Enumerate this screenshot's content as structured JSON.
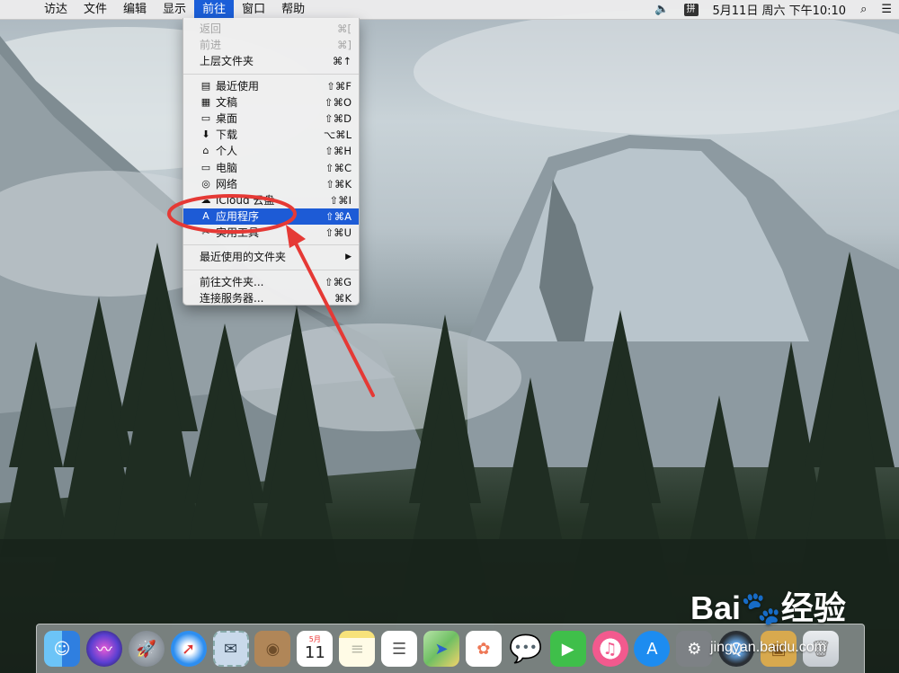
{
  "menubar": {
    "apple_icon": "apple-icon",
    "items": [
      {
        "label": "访达",
        "active": false
      },
      {
        "label": "文件",
        "active": false
      },
      {
        "label": "编辑",
        "active": false
      },
      {
        "label": "显示",
        "active": false
      },
      {
        "label": "前往",
        "active": true
      },
      {
        "label": "窗口",
        "active": false
      },
      {
        "label": "帮助",
        "active": false
      }
    ],
    "input_badge": "拼",
    "clock": "5月11日 周六 下午10:10"
  },
  "go_menu": {
    "items": [
      {
        "label": "返回",
        "shortcut": "⌘[",
        "disabled": true
      },
      {
        "label": "前进",
        "shortcut": "⌘]",
        "disabled": true
      },
      {
        "label": "上层文件夹",
        "shortcut": "⌘↑"
      },
      {
        "label": "最近使用",
        "shortcut": "⇧⌘F",
        "icon": "recents-icon"
      },
      {
        "label": "文稿",
        "shortcut": "⇧⌘O",
        "icon": "documents-icon"
      },
      {
        "label": "桌面",
        "shortcut": "⇧⌘D",
        "icon": "desktop-icon"
      },
      {
        "label": "下载",
        "shortcut": "⌥⌘L",
        "icon": "download-icon"
      },
      {
        "label": "个人",
        "shortcut": "⇧⌘H",
        "icon": "home-icon"
      },
      {
        "label": "电脑",
        "shortcut": "⇧⌘C",
        "icon": "computer-icon"
      },
      {
        "label": "网络",
        "shortcut": "⇧⌘K",
        "icon": "network-icon"
      },
      {
        "label": "iCloud 云盘",
        "shortcut": "⇧⌘I",
        "icon": "icloud-icon"
      },
      {
        "label": "应用程序",
        "shortcut": "⇧⌘A",
        "icon": "applications-icon",
        "highlighted": true
      },
      {
        "label": "实用工具",
        "shortcut": "⇧⌘U",
        "icon": "utilities-icon"
      },
      {
        "label": "最近使用的文件夹",
        "shortcut": "▶"
      },
      {
        "label": "前往文件夹...",
        "shortcut": "⇧⌘G"
      },
      {
        "label": "连接服务器...",
        "shortcut": "⌘K"
      }
    ]
  },
  "dock": {
    "apps": [
      {
        "name": "finder-icon",
        "color": "#3d8ee8"
      },
      {
        "name": "siri-icon",
        "color": "#6b3fd1"
      },
      {
        "name": "launchpad-icon",
        "color": "#9aa3ad"
      },
      {
        "name": "safari-icon",
        "color": "#2d8ef0"
      },
      {
        "name": "mail-stamp-icon",
        "color": "#7b9cc0"
      },
      {
        "name": "contacts-icon",
        "color": "#b08658"
      },
      {
        "name": "calendar-icon",
        "color": "#ffffff"
      },
      {
        "name": "notes-icon",
        "color": "#f7e27a"
      },
      {
        "name": "reminders-icon",
        "color": "#ffffff"
      },
      {
        "name": "maps-icon",
        "color": "#6fbf63"
      },
      {
        "name": "photos-icon",
        "color": "#ffffff"
      },
      {
        "name": "messages-icon",
        "color": "#4aa6f5"
      },
      {
        "name": "facetime-icon",
        "color": "#3fbf4a"
      },
      {
        "name": "itunes-icon",
        "color": "#f25a8e"
      },
      {
        "name": "app-store-icon",
        "color": "#1d8cf0"
      },
      {
        "name": "system-preferences-icon",
        "color": "#7d8185"
      },
      {
        "name": "quicktime-icon",
        "color": "#2a2f35"
      },
      {
        "name": "archive-icon",
        "color": "#d8a94e"
      },
      {
        "name": "trash-icon",
        "color": "#d6dadf"
      }
    ],
    "calendar_month": "5月",
    "calendar_day": "11"
  },
  "watermark": {
    "brand": "Bai🐾经验",
    "url": "jingyan.baidu.com"
  },
  "colors": {
    "accent": "#1d5bd6",
    "annotation": "#e53935"
  }
}
